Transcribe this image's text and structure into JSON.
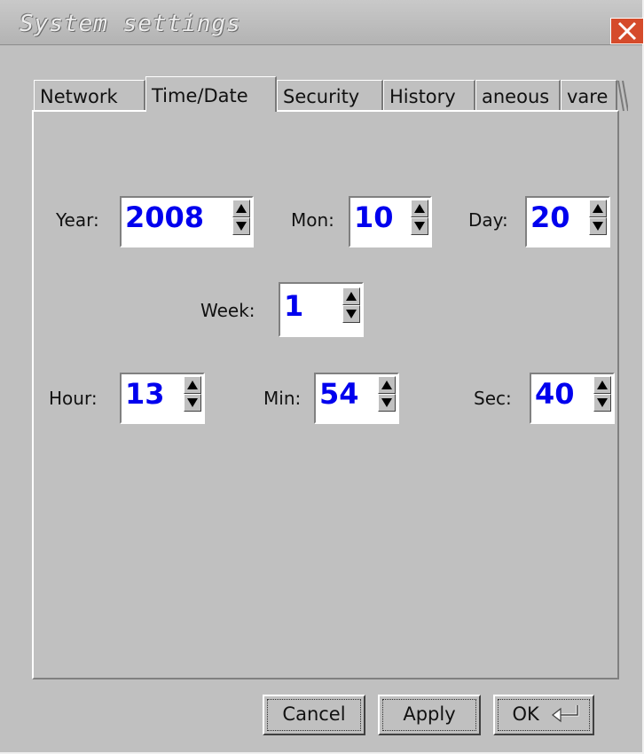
{
  "window": {
    "title": "System settings"
  },
  "tabs": [
    {
      "label": "Network"
    },
    {
      "label": "Time/Date"
    },
    {
      "label": "Security"
    },
    {
      "label": "History"
    },
    {
      "label": "aneous"
    },
    {
      "label": "vare"
    }
  ],
  "active_tab": "Time/Date",
  "fields": {
    "year": {
      "label": "Year:",
      "value": "2008"
    },
    "mon": {
      "label": "Mon:",
      "value": "10"
    },
    "day": {
      "label": "Day:",
      "value": "20"
    },
    "week": {
      "label": "Week:",
      "value": "1"
    },
    "hour": {
      "label": "Hour:",
      "value": "13"
    },
    "min": {
      "label": "Min:",
      "value": "54"
    },
    "sec": {
      "label": "Sec:",
      "value": "40"
    }
  },
  "buttons": {
    "cancel": "Cancel",
    "apply": "Apply",
    "ok": "OK",
    "ok_icon": "enter-key-icon"
  },
  "colors": {
    "accent_value": "#0000ee",
    "close_button": "#d54b2b",
    "window_bg": "#c0c0c0"
  }
}
